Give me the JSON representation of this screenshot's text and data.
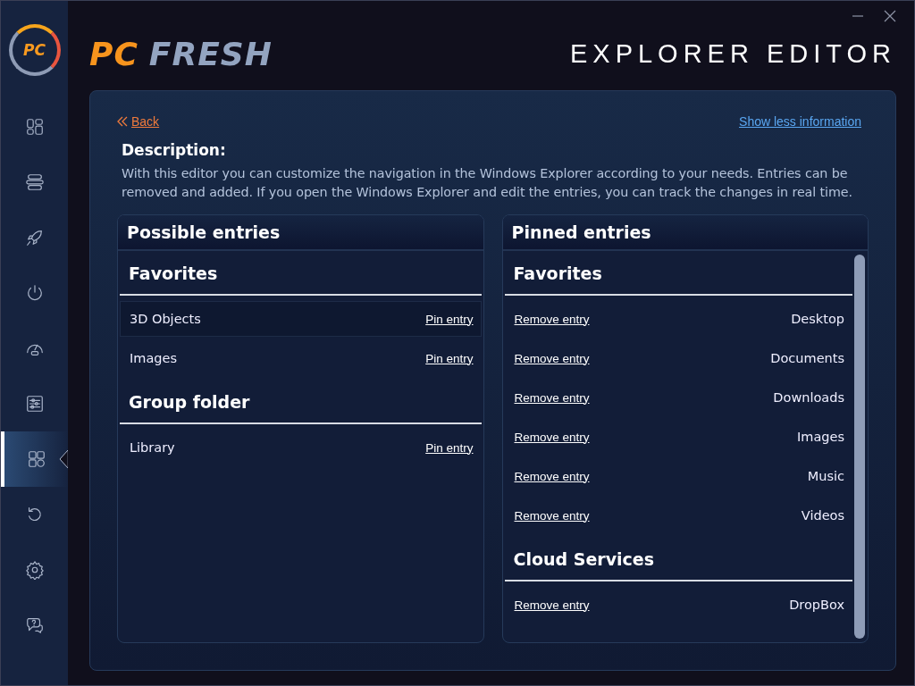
{
  "window": {
    "logo_mark": "PC",
    "brand": [
      "PC",
      "FRESH"
    ],
    "title": "EXPLORER EDITOR"
  },
  "sidebar": {
    "items": [
      {
        "kind": "dashboard",
        "selected": false
      },
      {
        "kind": "list",
        "selected": false
      },
      {
        "kind": "rocket",
        "selected": false
      },
      {
        "kind": "power",
        "selected": false
      },
      {
        "kind": "gauge",
        "selected": false
      },
      {
        "kind": "sliders",
        "selected": false
      },
      {
        "kind": "grid",
        "selected": true
      },
      {
        "kind": "undo",
        "selected": false
      },
      {
        "kind": "gear",
        "selected": false
      },
      {
        "kind": "help",
        "selected": false
      }
    ]
  },
  "back_link": "Back",
  "toggle_link": "Show less information",
  "description": {
    "heading": "Description:",
    "text": "With this editor you can customize the navigation in the Windows Explorer according to your needs. Entries can be removed and added. If you open the Windows Explorer and edit the entries, you can track the changes in real time."
  },
  "possible": {
    "title": "Possible entries",
    "groups": [
      {
        "title": "Favorites",
        "entries": [
          {
            "name": "3D Objects",
            "action": "Pin entry",
            "highlighted": true
          },
          {
            "name": "Images",
            "action": "Pin entry",
            "highlighted": false
          }
        ]
      },
      {
        "title": "Group folder",
        "entries": [
          {
            "name": "Library",
            "action": "Pin entry",
            "highlighted": false
          }
        ]
      }
    ]
  },
  "pinned": {
    "title": "Pinned entries",
    "groups": [
      {
        "title": "Favorites",
        "entries": [
          {
            "name": "Desktop",
            "action": "Remove entry"
          },
          {
            "name": "Documents",
            "action": "Remove entry"
          },
          {
            "name": "Downloads",
            "action": "Remove entry"
          },
          {
            "name": "Images",
            "action": "Remove entry"
          },
          {
            "name": "Music",
            "action": "Remove entry"
          },
          {
            "name": "Videos",
            "action": "Remove entry"
          }
        ]
      },
      {
        "title": "Cloud Services",
        "entries": [
          {
            "name": "DropBox",
            "action": "Remove entry"
          }
        ]
      }
    ]
  }
}
